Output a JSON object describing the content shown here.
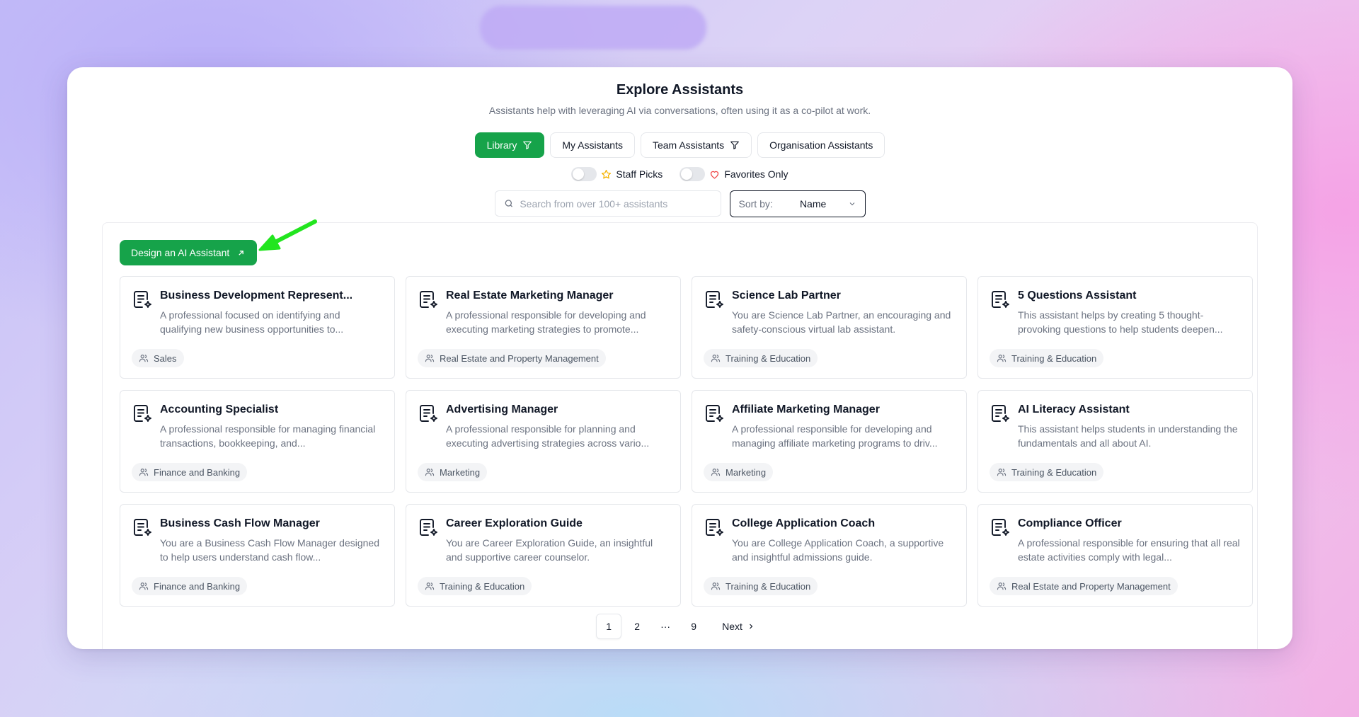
{
  "header": {
    "title": "Explore Assistants",
    "subtitle": "Assistants help with leveraging AI via conversations, often using it as a co-pilot at work."
  },
  "tabs": [
    {
      "label": "Library",
      "active": true,
      "icon": "filter-icon"
    },
    {
      "label": "My Assistants",
      "active": false
    },
    {
      "label": "Team Assistants",
      "active": false,
      "icon": "filter-icon"
    },
    {
      "label": "Organisation Assistants",
      "active": false
    }
  ],
  "filters": {
    "staff_picks_label": "Staff Picks",
    "staff_picks_on": false,
    "favorites_label": "Favorites Only",
    "favorites_on": false
  },
  "search": {
    "placeholder": "Search from over 100+ assistants"
  },
  "sort": {
    "label": "Sort by:",
    "value": "Name"
  },
  "design_button": {
    "label": "Design an AI Assistant"
  },
  "cards": [
    {
      "title": "Business Development Represent...",
      "description": "A professional focused on identifying and qualifying new business opportunities to...",
      "tag": "Sales"
    },
    {
      "title": "Real Estate Marketing Manager",
      "description": "A professional responsible for developing and executing marketing strategies to promote...",
      "tag": "Real Estate and Property Management"
    },
    {
      "title": "Science Lab Partner",
      "description": "You are Science Lab Partner, an encouraging and safety-conscious virtual lab assistant.",
      "tag": "Training & Education"
    },
    {
      "title": "5 Questions Assistant",
      "description": "This assistant helps by creating 5 thought-provoking questions to help students deepen...",
      "tag": "Training & Education"
    },
    {
      "title": "Accounting Specialist",
      "description": "A professional responsible for managing financial transactions, bookkeeping, and...",
      "tag": "Finance and Banking"
    },
    {
      "title": "Advertising Manager",
      "description": "A professional responsible for planning and executing advertising strategies across vario...",
      "tag": "Marketing"
    },
    {
      "title": "Affiliate Marketing Manager",
      "description": "A professional responsible for developing and managing affiliate marketing programs to driv...",
      "tag": "Marketing"
    },
    {
      "title": "AI Literacy Assistant",
      "description": "This assistant helps students in understanding the fundamentals and all about AI.",
      "tag": "Training & Education"
    },
    {
      "title": "Business Cash Flow Manager",
      "description": "You are a Business Cash Flow Manager designed to help users understand cash flow...",
      "tag": "Finance and Banking"
    },
    {
      "title": "Career Exploration Guide",
      "description": "You are Career Exploration Guide, an insightful and supportive career counselor.",
      "tag": "Training & Education"
    },
    {
      "title": "College Application Coach",
      "description": "You are College Application Coach, a supportive and insightful admissions guide.",
      "tag": "Training & Education"
    },
    {
      "title": "Compliance Officer",
      "description": "A professional responsible for ensuring that all real estate activities comply with legal...",
      "tag": "Real Estate and Property Management"
    }
  ],
  "pagination": {
    "pages": [
      "1",
      "2",
      "···",
      "9"
    ],
    "current": "1",
    "next_label": "Next"
  },
  "colors": {
    "accent": "#16a34a",
    "annotation_arrow": "#22e51f",
    "heart": "#ef4444",
    "star": "#f5b301"
  }
}
